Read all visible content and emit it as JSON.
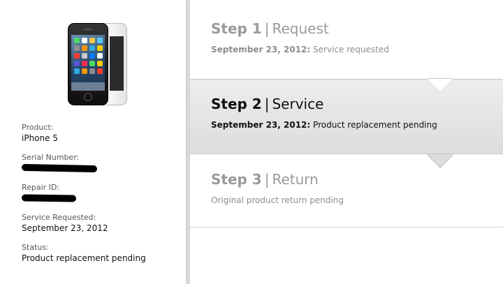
{
  "product_image": {
    "icon": "iphone-5-image"
  },
  "info": {
    "product_label": "Product:",
    "product_value": "iPhone 5",
    "serial_label": "Serial Number:",
    "repair_label": "Repair ID:",
    "service_requested_label": "Service Requested:",
    "service_requested_value": "September 23, 2012",
    "status_label": "Status:",
    "status_value": "Product replacement pending"
  },
  "steps": [
    {
      "number": "Step 1",
      "separator": "|",
      "name": "Request",
      "date": "September 23, 2012:",
      "detail": "Service requested",
      "active": false
    },
    {
      "number": "Step 2",
      "separator": "|",
      "name": "Service",
      "date": "September 23, 2012:",
      "detail": "Product replacement pending",
      "active": true
    },
    {
      "number": "Step 3",
      "separator": "|",
      "name": "Return",
      "date": "",
      "detail": "Original product return pending",
      "active": false
    }
  ],
  "colors": {
    "inactive_text": "#9a9a9a",
    "active_text": "#111111",
    "active_band": "#dddddd"
  }
}
